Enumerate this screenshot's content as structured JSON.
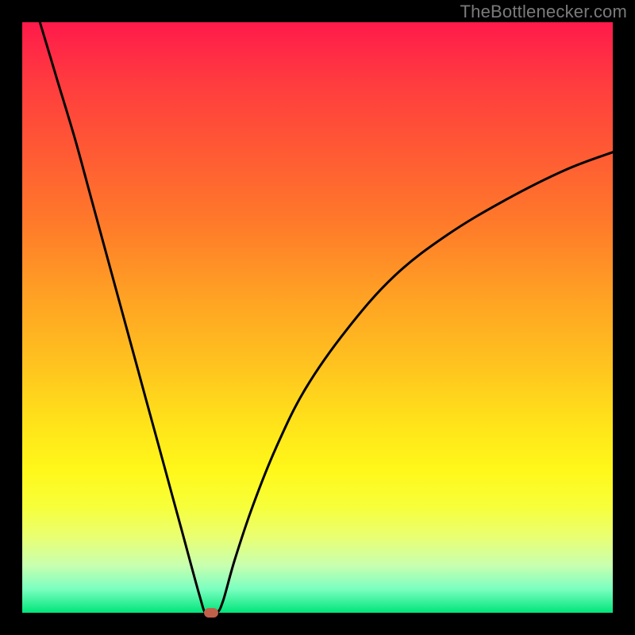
{
  "watermark": "TheBottlenecker.com",
  "chart_data": {
    "type": "line",
    "title": "",
    "xlabel": "",
    "ylabel": "",
    "xlim": [
      0,
      100
    ],
    "ylim": [
      0,
      100
    ],
    "series": [
      {
        "name": "bottleneck-curve",
        "x": [
          0,
          3,
          6,
          9,
          12,
          15,
          18,
          21,
          24,
          27,
          30,
          31,
          32,
          33,
          34,
          36,
          39,
          43,
          48,
          55,
          63,
          72,
          82,
          92,
          100
        ],
        "values": [
          110,
          100,
          90,
          80,
          69,
          58,
          47,
          36,
          25,
          14,
          3,
          0,
          0,
          0,
          2,
          9,
          18,
          28,
          38,
          48,
          57,
          64,
          70,
          75,
          78
        ]
      }
    ],
    "marker": {
      "x": 32,
      "y": 0
    },
    "colors": {
      "curve": "#000000",
      "marker": "#c0604a",
      "gradient_top": "#ff1a4b",
      "gradient_bottom": "#00e57a"
    }
  }
}
